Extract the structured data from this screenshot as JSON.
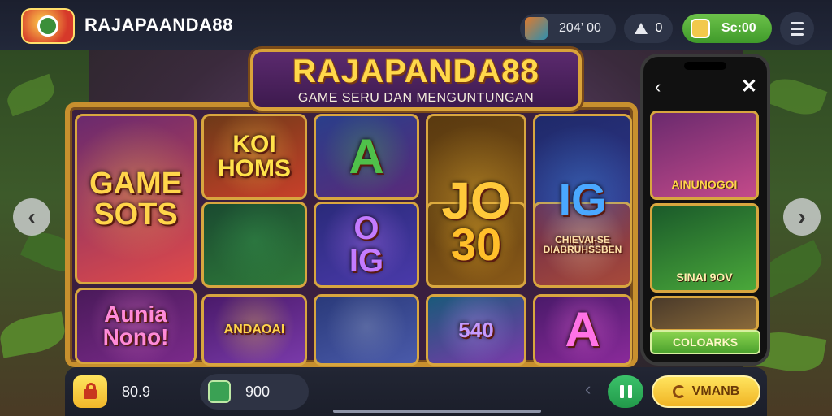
{
  "header": {
    "brand": "RAJAPAANDA88",
    "balance": "204’ 00",
    "notifications": "0",
    "deposit_label": "Sc:00"
  },
  "banner": {
    "title": "RAJAPANDA88",
    "subtitle": "GAME SERU DAN MENGUNTUNGAN"
  },
  "tiles": [
    {
      "name": "game-slots",
      "label": "GAME\nSOTS",
      "color": "#ffd54a"
    },
    {
      "name": "koi-homs",
      "label": "KOI\nHOMS",
      "color": "#ffe24a"
    },
    {
      "name": "symbol-a-green",
      "label": "A",
      "color": "#4fc14a"
    },
    {
      "name": "symbol-jo",
      "label": "JO",
      "color": "#ffc93a"
    },
    {
      "name": "symbol-ig",
      "label": "IG",
      "color": "#4aa8ff"
    },
    {
      "name": "green-cylinder",
      "label": "",
      "color": "#3aa154"
    },
    {
      "name": "symbol-o-ig",
      "label": "O\nIG",
      "color": "#c47bff"
    },
    {
      "name": "symbol-30",
      "label": "30",
      "color": "#ffbf2a"
    },
    {
      "name": "cat-bonus",
      "label": "CHIEVAI-SE\nDIABRUHSSBEN",
      "color": "#ffe1a8"
    },
    {
      "name": "aunia-nono",
      "label": "Aunia\nNono!",
      "color": "#ff8ad8"
    },
    {
      "name": "andaoai",
      "label": "ANDAOAI",
      "color": "#ffd54a"
    },
    {
      "name": "grey-cat",
      "label": "",
      "color": "#9aa7c4"
    },
    {
      "name": "cube-540",
      "label": "540",
      "color": "#c79bff"
    },
    {
      "name": "symbol-a-pink",
      "label": "A",
      "color": "#ff72e6"
    }
  ],
  "phone": {
    "tiles": [
      {
        "name": "ainunogoi",
        "label": "AINUNOGOI"
      },
      {
        "name": "sinai-90v",
        "label": "SINAI 9OV"
      },
      {
        "name": "gold-coins",
        "label": ""
      }
    ],
    "button_label": "COLOARKS"
  },
  "bottom": {
    "lock_value": "80.9",
    "chip_value": "900",
    "action_label": "VMANB"
  }
}
